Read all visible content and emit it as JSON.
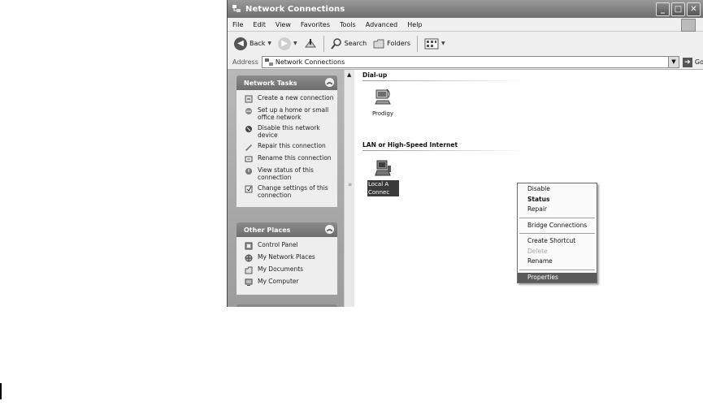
{
  "window": {
    "title": "Network Connections",
    "controls": [
      "_",
      "□",
      "✕"
    ]
  },
  "menu": [
    "File",
    "Edit",
    "View",
    "Favorites",
    "Tools",
    "Advanced",
    "Help"
  ],
  "toolbar": {
    "back_label": "Back",
    "search_label": "Search",
    "folders_label": "Folders"
  },
  "address": {
    "label": "Address",
    "value": "Network Connections",
    "go_label": "Go"
  },
  "network_tasks": {
    "title": "Network Tasks",
    "items": [
      {
        "label": "Create a new connection",
        "icon": "new-connection-icon"
      },
      {
        "label": "Set up a home or small office network",
        "icon": "home-network-icon"
      },
      {
        "label": "Disable this network device",
        "icon": "disable-device-icon"
      },
      {
        "label": "Repair this connection",
        "icon": "repair-icon"
      },
      {
        "label": "Rename this connection",
        "icon": "rename-icon"
      },
      {
        "label": "View status of this connection",
        "icon": "status-icon"
      },
      {
        "label": "Change settings of this connection",
        "icon": "settings-icon"
      }
    ]
  },
  "other_places": {
    "title": "Other Places",
    "items": [
      {
        "label": "Control Panel",
        "icon": "control-panel-icon"
      },
      {
        "label": "My Network Places",
        "icon": "network-places-icon"
      },
      {
        "label": "My Documents",
        "icon": "documents-icon"
      },
      {
        "label": "My Computer",
        "icon": "computer-icon"
      }
    ]
  },
  "groups": {
    "dialup": {
      "title": "Dial-up",
      "item": "Prodigy"
    },
    "lan": {
      "title": "LAN or High-Speed Internet",
      "item_line1": "Local A",
      "item_line2": "Connec"
    }
  },
  "context_menu": {
    "disable": "Disable",
    "status": "Status",
    "repair": "Repair",
    "bridge": "Bridge Connections",
    "shortcut": "Create Shortcut",
    "delete": "Delete",
    "rename": "Rename",
    "properties": "Properties"
  }
}
